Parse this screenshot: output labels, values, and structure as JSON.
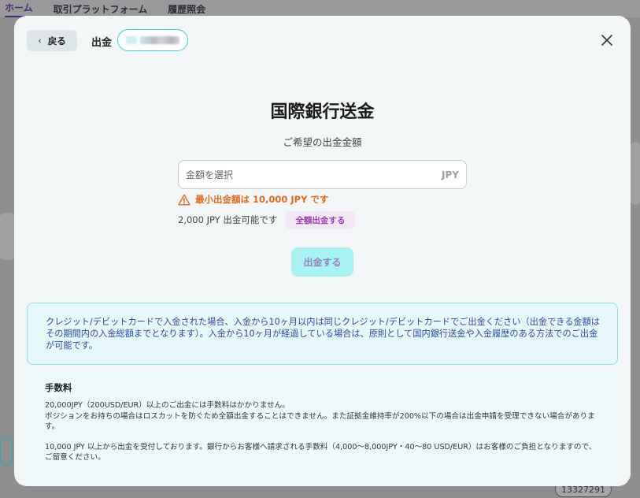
{
  "background": {
    "nav_tabs": [
      "ホーム",
      "取引プラットフォーム",
      "履歴照会"
    ],
    "account_number": "13327291"
  },
  "modal": {
    "back_label": "戻る",
    "withdraw_label": "出金",
    "title": "国際銀行送金",
    "subtitle": "ご希望の出金金額",
    "amount_input": {
      "placeholder": "金額を選択",
      "value": "",
      "currency": "JPY"
    },
    "warning": "最小出金額は 10,000 JPY です",
    "available_text": "2,000 JPY 出金可能です",
    "withdraw_all_label": "全額出金する",
    "submit_label": "出金する",
    "info_notice": "クレジット/デビットカードで入金された場合、入金から10ヶ月以内は同じクレジット/デビットカードでご出金ください（出金できる金額はその期間内の入金総額までとなります）。入金から10ヶ月が経過している場合は、原則として国内銀行送金や入金履歴のある方法でのご出金が可能です。",
    "fees": {
      "title": "手数料",
      "line1": "20,000JPY（200USD/EUR）以上のご出金には手数料はかかりません。",
      "line2": "ポジションをお持ちの場合はロスカットを防ぐため全額出金することはできません。また証拠金維持率が200%以下の場合は出金申請を受理できない場合があります。",
      "line3": "10,000 JPY 以上から出金を受付しております。銀行からお客様へ請求される手数料（4,000〜8,000JPY・40〜80 USD/EUR）はお客様のご負担となりますので、ご留意ください。"
    }
  },
  "colors": {
    "accent_teal": "#3ed0cf",
    "warning": "#e26a1c",
    "purple": "#9a3db3",
    "info_text": "#2a4aa3"
  },
  "icons": {
    "back": "chevron-left-icon",
    "close": "close-icon",
    "warning": "warning-triangle-icon"
  }
}
